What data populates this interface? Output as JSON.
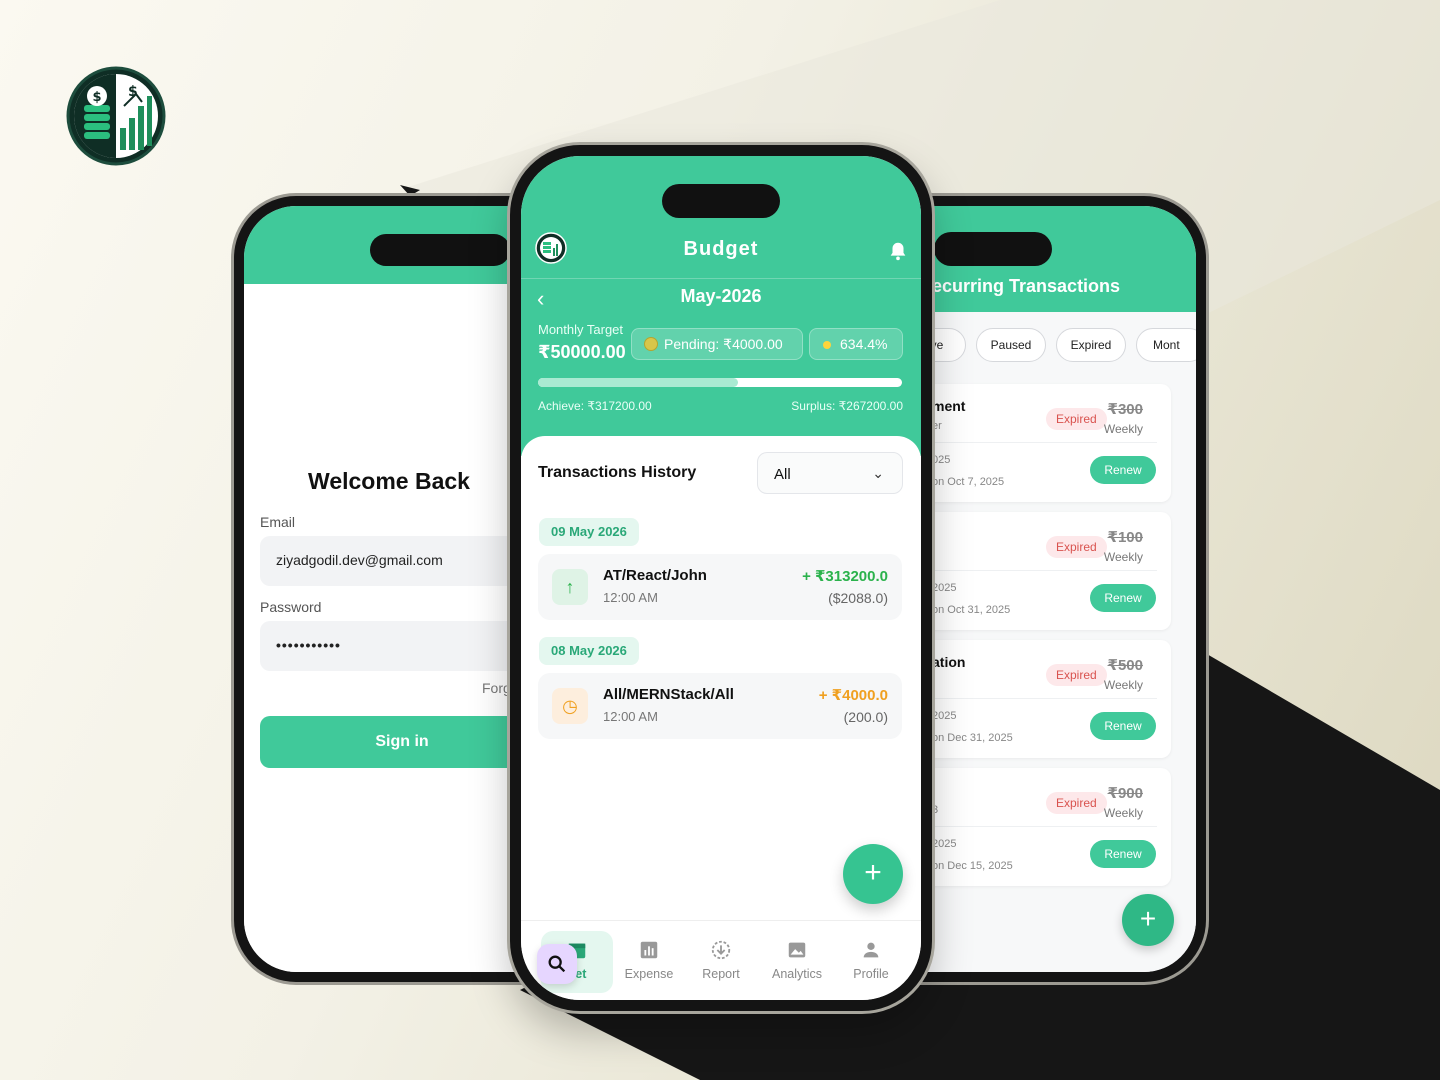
{
  "left_screen": {
    "title": "Welcome Back",
    "email_label": "Email",
    "email_value": "ziyadgodil.dev@gmail.com",
    "password_label": "Password",
    "password_value": "•••••••••••",
    "forgot_label": "Forg",
    "signin_label": "Sign in"
  },
  "center_screen": {
    "title": "Budget",
    "month": "May-2026",
    "monthly_target_label": "Monthly Target",
    "monthly_target_value": "₹50000.00",
    "pending": "Pending: ₹4000.00",
    "percent": "634.4%",
    "progress_fraction": 0.55,
    "achieve": "Achieve: ₹317200.00",
    "surplus": "Surplus: ₹267200.00",
    "history_title": "Transactions History",
    "filter_value": "All",
    "groups": [
      {
        "date": "09 May 2026",
        "tx": {
          "name": "AT/React/John",
          "time": "12:00 AM",
          "amount": "+ ₹313200.0",
          "sub": "($2088.0)"
        }
      },
      {
        "date": "08 May 2026",
        "tx": {
          "name": "All/MERNStack/All",
          "time": "12:00 AM",
          "amount": "+ ₹4000.0",
          "sub": "(200.0)"
        }
      }
    ],
    "nav": [
      {
        "label": "get",
        "icon": "calendar-icon"
      },
      {
        "label": "Expense",
        "icon": "bar-chart-icon"
      },
      {
        "label": "Report",
        "icon": "download-icon"
      },
      {
        "label": "Analytics",
        "icon": "image-icon"
      },
      {
        "label": "Profile",
        "icon": "user-icon"
      }
    ]
  },
  "right_screen": {
    "title": "ecurring Transactions",
    "chips": [
      "ctive",
      "Paused",
      "Expired",
      "Mont"
    ],
    "cards": [
      {
        "t1": "ment",
        "t2": "er",
        "t3": "025",
        "t4": "on Oct 7, 2025",
        "badge": "Expired",
        "amount": "₹300",
        "freq": "Weekly",
        "renew": "Renew"
      },
      {
        "t1": "",
        "t2": "",
        "t3": "2025",
        "t4": "on Oct 31, 2025",
        "badge": "Expired",
        "amount": "₹100",
        "freq": "Weekly",
        "renew": "Renew"
      },
      {
        "t1": "ation",
        "t2": "",
        "t3": "2025",
        "t4": "on Dec 31, 2025",
        "badge": "Expired",
        "amount": "₹500",
        "freq": "Weekly",
        "renew": "Renew"
      },
      {
        "t1": "",
        "t2": "3",
        "t3": "2025",
        "t4": "on Dec 15, 2025",
        "badge": "Expired",
        "amount": "₹900",
        "freq": "Weekly",
        "renew": "Renew"
      }
    ],
    "fab": "+"
  },
  "colors": {
    "brand_green": "#40c99a",
    "expired_red": "#d9534f",
    "income_green": "#2bb24c",
    "pending_orange": "#f0a020"
  }
}
